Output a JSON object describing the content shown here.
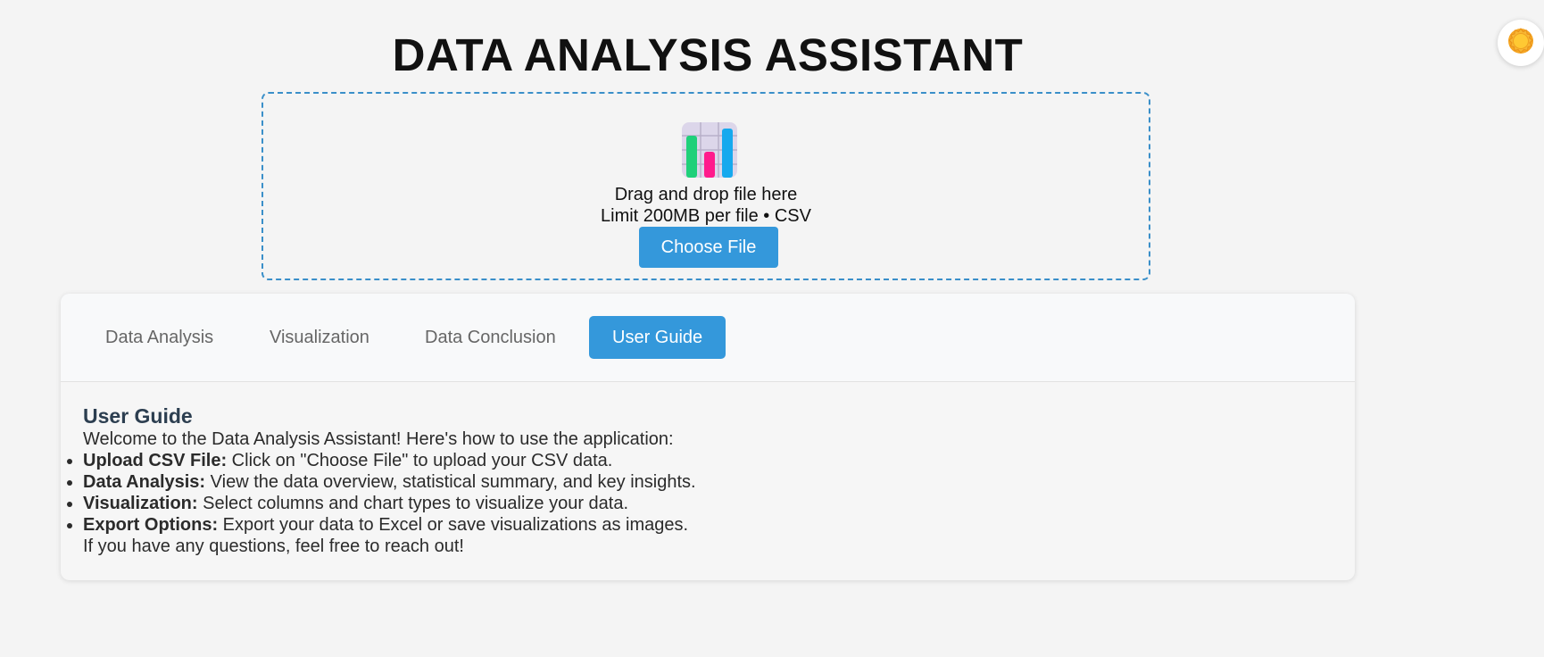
{
  "header": {
    "title": "DATA ANALYSIS ASSISTANT",
    "theme_icon": "sun-icon"
  },
  "upload": {
    "icon": "bar-chart-icon",
    "drag_text": "Drag and drop file here",
    "limit_text": "Limit 200MB per file • CSV",
    "button_label": "Choose File"
  },
  "tabs": [
    {
      "label": "Data Analysis",
      "active": false
    },
    {
      "label": "Visualization",
      "active": false
    },
    {
      "label": "Data Conclusion",
      "active": false
    },
    {
      "label": "User Guide",
      "active": true
    }
  ],
  "guide": {
    "title": "User Guide",
    "intro": "Welcome to the Data Analysis Assistant! Here's how to use the application:",
    "items": [
      {
        "term": "Upload CSV File:",
        "text": " Click on \"Choose File\" to upload your CSV data."
      },
      {
        "term": "Data Analysis:",
        "text": " View the data overview, statistical summary, and key insights."
      },
      {
        "term": "Visualization:",
        "text": " Select columns and chart types to visualize your data."
      },
      {
        "term": "Export Options:",
        "text": " Export your data to Excel or save visualizations as images."
      }
    ],
    "outro": "If you have any questions, feel free to reach out!"
  },
  "colors": {
    "accent": "#3498db",
    "dropzone_border": "#3a8fc9",
    "heading": "#2c3e50"
  }
}
